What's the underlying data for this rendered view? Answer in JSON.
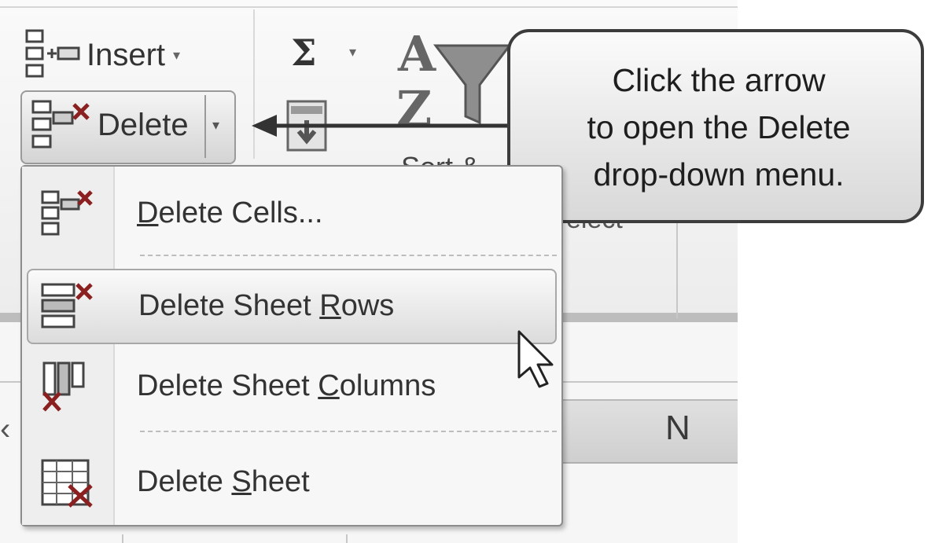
{
  "ribbon": {
    "insert_label": "Insert",
    "insert_arrow": "▾",
    "delete_label": "Delete",
    "delete_arrow": "▾",
    "sigma_symbol": "Σ",
    "sigma_arrow": "▾",
    "sort_partial_label": "Sort &",
    "find_partial_label": "elect"
  },
  "callout": {
    "lines": [
      "Click the arrow",
      "to open the Delete",
      "drop-down menu."
    ]
  },
  "menu": {
    "items": [
      {
        "pre": "",
        "key": "D",
        "post": "elete Cells...",
        "icon": "delete-cells-icon",
        "state": "normal"
      },
      {
        "pre": "Delete Sheet ",
        "key": "R",
        "post": "ows",
        "icon": "delete-rows-icon",
        "state": "hover"
      },
      {
        "pre": "Delete Sheet ",
        "key": "C",
        "post": "olumns",
        "icon": "delete-columns-icon",
        "state": "normal"
      },
      {
        "pre": "Delete ",
        "key": "S",
        "post": "heet",
        "icon": "delete-sheet-icon",
        "state": "normal"
      }
    ]
  },
  "grid": {
    "column_header": "N",
    "left_chevron": "‹"
  },
  "colors": {
    "callout_border": "#3c3c3c",
    "menu_border": "#8c8c8c",
    "delete_red": "#8a2020"
  }
}
